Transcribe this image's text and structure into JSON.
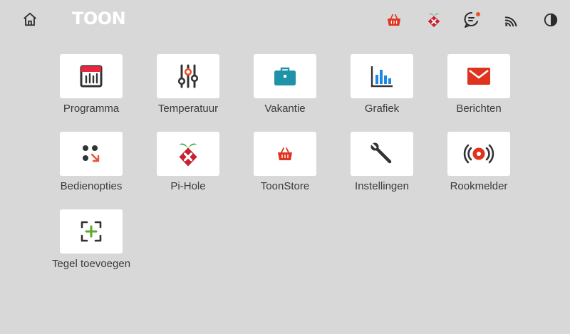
{
  "header": {
    "logo_text": "TOON",
    "home_icon": "home-icon",
    "status_icons": [
      "basket-icon",
      "pihole-icon",
      "chat-notification-icon",
      "wifi-icon",
      "contrast-icon"
    ],
    "notification_color": "#e8542a"
  },
  "tiles": [
    {
      "label": "Programma",
      "icon": "calendar-icon"
    },
    {
      "label": "Temperatuur",
      "icon": "sliders-icon"
    },
    {
      "label": "Vakantie",
      "icon": "suitcase-icon"
    },
    {
      "label": "Grafiek",
      "icon": "bar-chart-icon"
    },
    {
      "label": "Berichten",
      "icon": "envelope-icon"
    },
    {
      "label": "Bedienopties",
      "icon": "dots-arrow-icon"
    },
    {
      "label": "Pi-Hole",
      "icon": "pihole-icon"
    },
    {
      "label": "ToonStore",
      "icon": "basket-icon"
    },
    {
      "label": "Instellingen",
      "icon": "wrench-icon"
    },
    {
      "label": "Rookmelder",
      "icon": "smoke-alarm-icon"
    },
    {
      "label": "Tegel toevoegen",
      "icon": "add-tile-icon"
    }
  ],
  "colors": {
    "background": "#d8d8d8",
    "tile": "#ffffff",
    "label": "#3b3b3b",
    "accent_red": "#e0331e",
    "accent_orange": "#e8542a",
    "accent_blue": "#1e88e5",
    "accent_teal": "#1e93a8",
    "accent_green": "#5fa831",
    "icon_dark": "#333333"
  }
}
